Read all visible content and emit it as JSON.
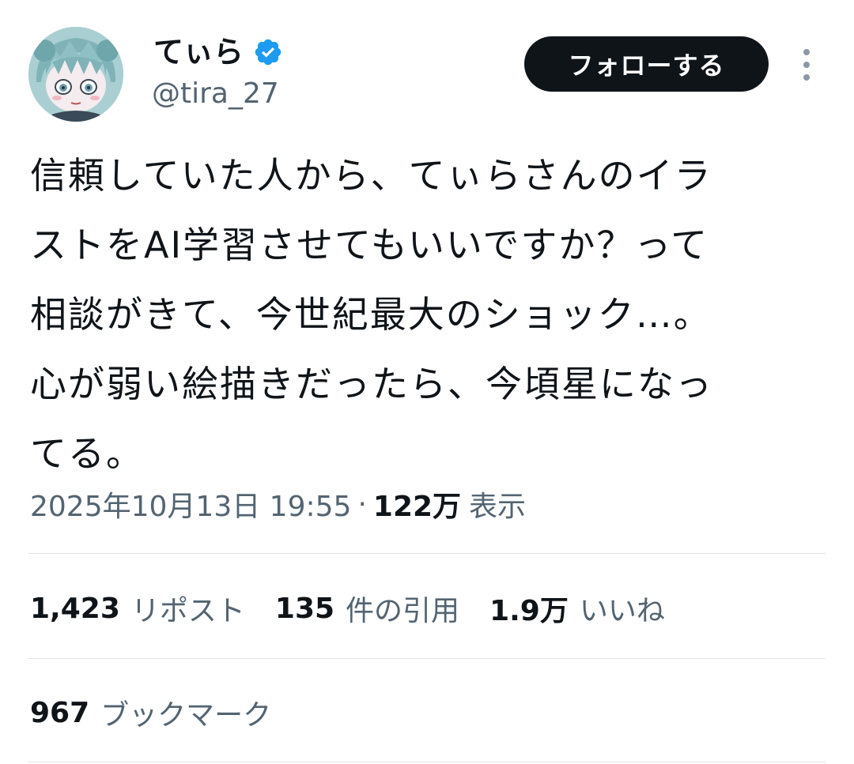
{
  "author": {
    "display_name": "てぃら",
    "handle": "@tira_27",
    "verified_icon": "verified-badge-icon",
    "avatar_icon": "avatar-illustration"
  },
  "header": {
    "follow_label": "フォローする",
    "more_icon": "more-vertical-icon"
  },
  "tweet": {
    "lines": [
      "信頼していた人から、てぃらさんのイラ",
      "ストをAI学習させてもいいですか？って",
      "相談がきて、今世紀最大のショック…。",
      "心が弱い絵描きだったら、今頃星になっ",
      "てる。"
    ]
  },
  "meta": {
    "timestamp": "2025年10月13日 19:55",
    "separator": "·",
    "views_count": "122万",
    "views_label": "表示"
  },
  "stats": {
    "reposts": {
      "count": "1,423",
      "label": "リポスト"
    },
    "quotes": {
      "count": "135",
      "label": "件の引用"
    },
    "likes": {
      "count": "1.9万",
      "label": "いいね"
    },
    "bookmarks": {
      "count": "967",
      "label": "ブックマーク"
    }
  },
  "colors": {
    "text_primary": "#0f1419",
    "text_secondary": "#536471",
    "verified_blue": "#1d9bf0",
    "divider": "#dfe3e6"
  }
}
